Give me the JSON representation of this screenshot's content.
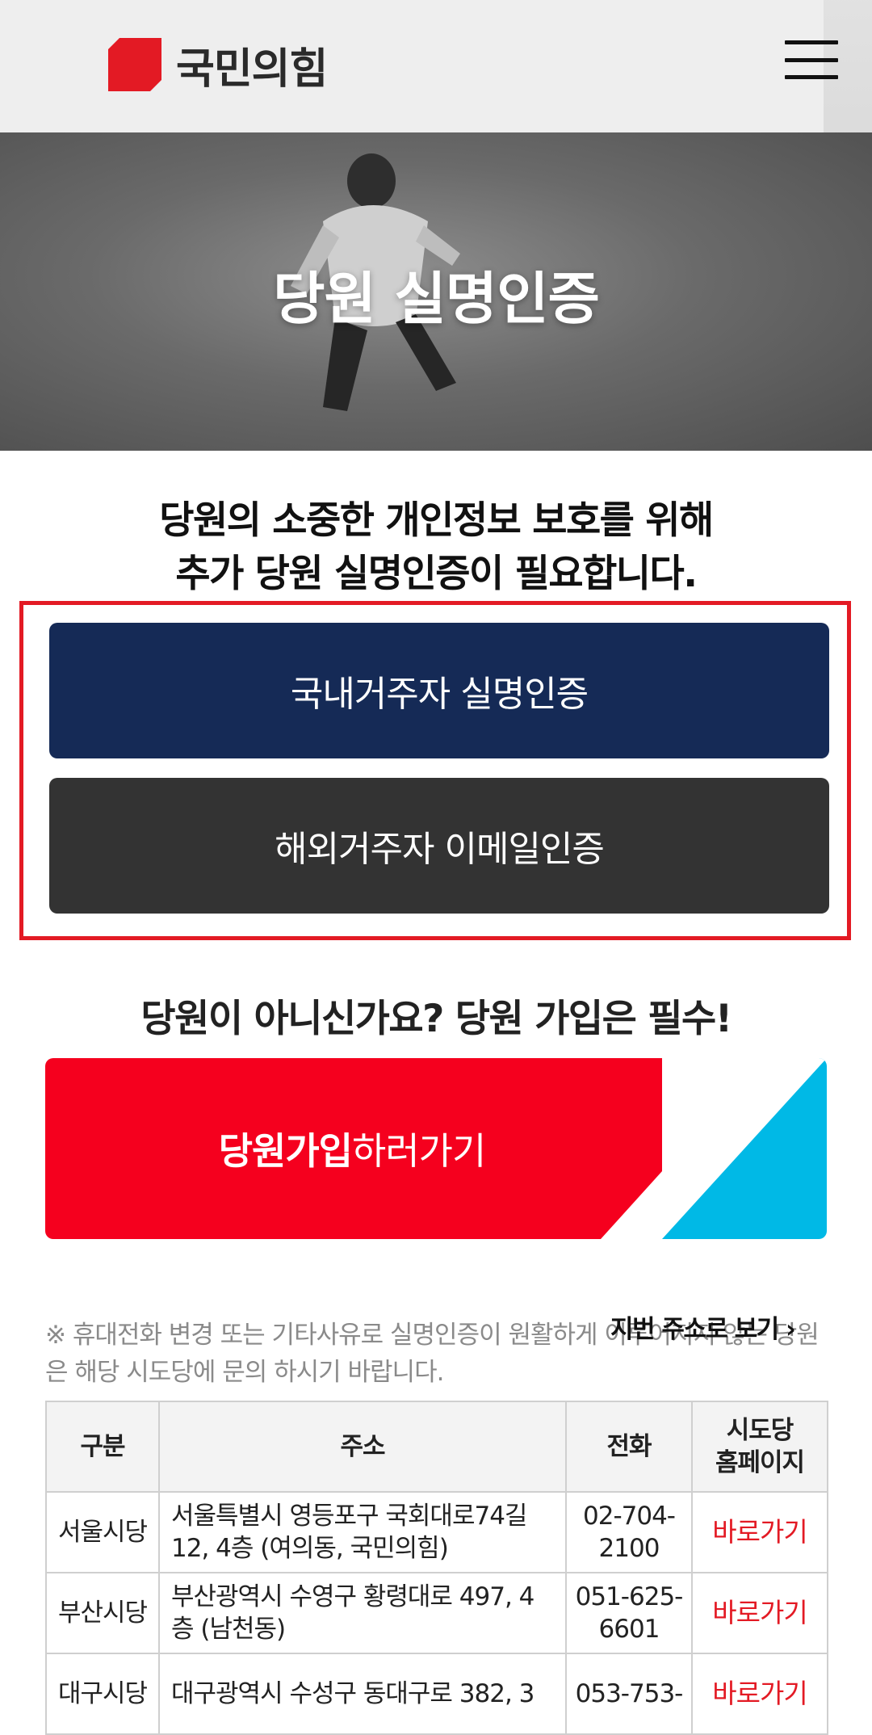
{
  "header": {
    "logo_text": "국민의힘",
    "brand_color": "#e31a24"
  },
  "hero": {
    "title": "당원 실명인증"
  },
  "intro": {
    "line1": "당원의 소중한 개인정보 보호를 위해",
    "line2": "추가 당원 실명인증이 필요합니다."
  },
  "verify": {
    "domestic_label": "국내거주자 실명인증",
    "overseas_label": "해외거주자 이메일인증",
    "domestic_color": "#152a56",
    "overseas_color": "#333333"
  },
  "join": {
    "question": "당원이 아니신가요? 당원 가입은 필수!",
    "label_strong": "당원가입",
    "label_rest": "하러가기",
    "red": "#f5001e",
    "blue": "#00b9e6"
  },
  "notice": {
    "text": "※ 휴대전화 변경 또는 기타사유로 실명인증이 원활하게 이루어지지 않는 당원은 해당 시도당에 문의 하시기 바랍니다.",
    "jibeon_link": "지번 주소로 보기"
  },
  "table": {
    "headers": [
      "구분",
      "주소",
      "전화",
      "시도당\n홈페이지"
    ],
    "rows": [
      {
        "region": "서울시당",
        "address": "서울특별시 영등포구 국회대로74길 12, 4층 (여의동, 국민의힘)",
        "phone": "02-704-2100",
        "link": "바로가기"
      },
      {
        "region": "부산시당",
        "address": "부산광역시 수영구 황령대로 497, 4층 (남천동)",
        "phone": "051-625-6601",
        "link": "바로가기"
      },
      {
        "region": "대구시당",
        "address": "대구광역시 수성구 동대구로 382, 3",
        "phone": "053-753-",
        "link": "바로가기"
      }
    ]
  }
}
